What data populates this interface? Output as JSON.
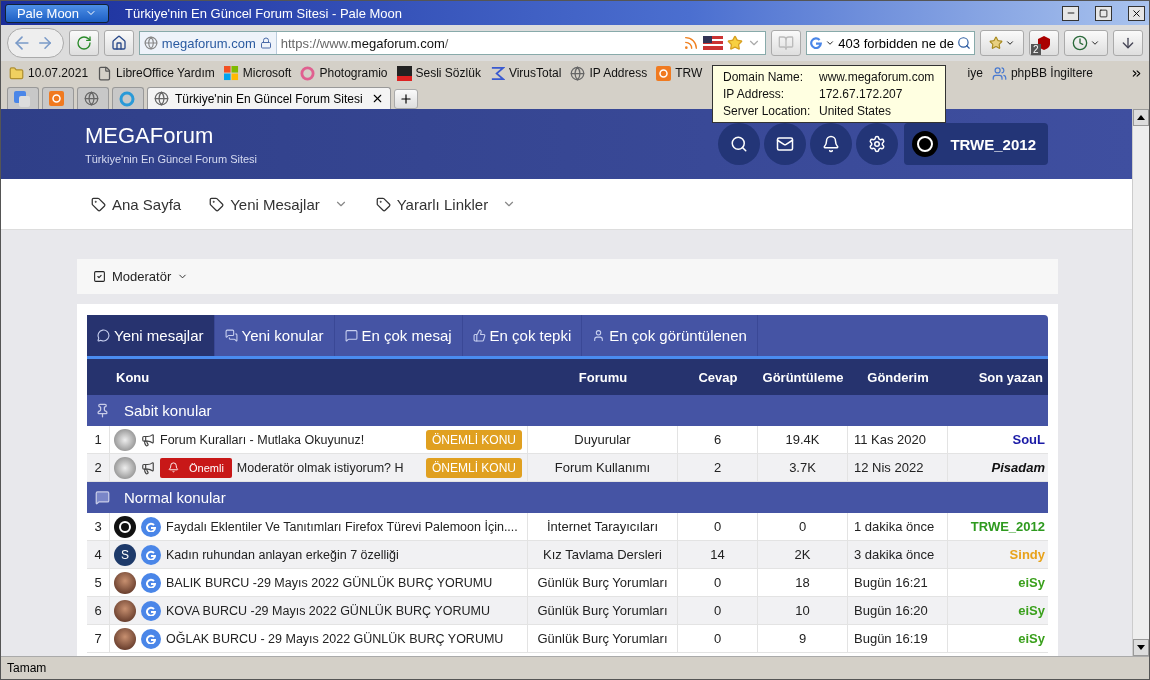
{
  "window": {
    "menu_button": "Pale Moon",
    "title": "Türkiye'nin En Güncel Forum Sitesi - Pale Moon"
  },
  "toolbar": {
    "identity": "megaforum.com",
    "url_parts": [
      {
        "text": "https://www.",
        "emphasis": false
      },
      {
        "text": "megaforum.com",
        "emphasis": true
      },
      {
        "text": "/",
        "emphasis": false
      }
    ],
    "search": "403 forbidden ne de",
    "addon_badge": "2"
  },
  "bookmarks": [
    {
      "label": "10.07.2021",
      "kind": "folder"
    },
    {
      "label": "LibreOffice Yardım",
      "kind": "page"
    },
    {
      "label": "Microsoft",
      "kind": "windows"
    },
    {
      "label": "Photogramio",
      "kind": "ring"
    },
    {
      "label": "Sesli Sözlük",
      "kind": "dict"
    },
    {
      "label": "VirusTotal",
      "kind": "sigma"
    },
    {
      "label": "IP Address",
      "kind": "globe"
    },
    {
      "label": "TRW",
      "kind": "xampp"
    },
    {
      "label": "iye",
      "kind": "none"
    },
    {
      "label": "phpBB İngiltere",
      "kind": "users"
    }
  ],
  "tabs": [
    {
      "kind": "translate",
      "selected": false
    },
    {
      "kind": "xampp",
      "selected": false
    },
    {
      "kind": "globe",
      "selected": false
    },
    {
      "kind": "refresh",
      "selected": false
    },
    {
      "kind": "globe",
      "label": "Türkiye'nin En Güncel Forum Sitesi",
      "selected": true
    }
  ],
  "tooltip": [
    {
      "name": "Domain Name:",
      "value": "www.megaforum.com"
    },
    {
      "name": "IP Address:",
      "value": "172.67.172.207"
    },
    {
      "name": "Server Location:",
      "value": "United States"
    }
  ],
  "site": {
    "title": "MEGAForum",
    "subtitle": "Türkiye'nin En Güncel Forum Sitesi",
    "header_buttons": [
      {
        "kind": "search"
      },
      {
        "kind": "mail"
      },
      {
        "kind": "bell"
      },
      {
        "kind": "settings"
      }
    ],
    "user": "TRWE_2012",
    "nav": [
      {
        "label": "Ana Sayfa",
        "dropdown": false
      },
      {
        "label": "Yeni Mesajlar",
        "dropdown": true
      },
      {
        "label": "Yararlı Linkler",
        "dropdown": true
      }
    ],
    "moderator": "Moderatör",
    "widget_tabs": [
      {
        "label": "Yeni mesajlar",
        "selected": true
      },
      {
        "label": "Yeni konular",
        "selected": false
      },
      {
        "label": "En çok mesaj",
        "selected": false
      },
      {
        "label": "En çok tepki",
        "selected": false
      },
      {
        "label": "En çok görüntülenen",
        "selected": false
      }
    ],
    "columns": [
      "Konu",
      "Forumu",
      "Cevap",
      "Görüntüleme",
      "Gönderim",
      "Son yazan"
    ],
    "sections": [
      {
        "title": "Sabit konular",
        "kind": "pin",
        "rows": [
          {
            "num": "1",
            "avatar": {
              "kind": "photo"
            },
            "prefix": "ÖNEMLİ KONU",
            "title": "Forum Kuralları - Mutlaka Okuyunuz!",
            "forum": "Duyurular",
            "replies": "6",
            "views": "19.4K",
            "date": "11 Kas 2020",
            "author": "SouL",
            "color": "#1a1aa6",
            "italic": false
          },
          {
            "num": "2",
            "avatar": {
              "kind": "photo"
            },
            "prefix": "ÖNEMLİ KONU",
            "flag": "Önemli",
            "title": "Moderatör olmak istiyorum? H",
            "forum": "Forum Kullanımı",
            "replies": "2",
            "views": "3.7K",
            "date": "12 Nis 2022",
            "author": "Pisadam",
            "color": "#111111",
            "italic": true
          }
        ]
      },
      {
        "title": "Normal konular",
        "kind": "chat",
        "rows": [
          {
            "num": "3",
            "avatar": {
              "kind": "logo"
            },
            "title": "Faydalı Eklentiler Ve Tanıtımları Firefox Türevi Palemoon İçin....",
            "forum": "İnternet Tarayıcıları",
            "replies": "0",
            "views": "0",
            "date": "1 dakika önce",
            "author": "TRWE_2012",
            "color": "#2e9a1f",
            "italic": false
          },
          {
            "num": "4",
            "avatar": {
              "kind": "letter",
              "letter": "S"
            },
            "title": "Kadın ruhundan anlayan erkeğin 7 özelliği",
            "forum": "Kız Tavlama Dersleri",
            "replies": "14",
            "views": "2K",
            "date": "3 dakika önce",
            "author": "Sindy",
            "color": "#e8a21a",
            "italic": false
          },
          {
            "num": "5",
            "avatar": {
              "kind": "portrait"
            },
            "title": "BALIK BURCU -29 Mayıs 2022 GÜNLÜK BURÇ YORUMU",
            "forum": "Günlük Burç Yorumları",
            "replies": "0",
            "views": "18",
            "date": "Bugün 16:21",
            "author": "eiSy",
            "color": "#3aa01c",
            "italic": false
          },
          {
            "num": "6",
            "avatar": {
              "kind": "portrait"
            },
            "title": "KOVA BURCU -29 Mayıs 2022 GÜNLÜK BURÇ YORUMU",
            "forum": "Günlük Burç Yorumları",
            "replies": "0",
            "views": "10",
            "date": "Bugün 16:20",
            "author": "eiSy",
            "color": "#3aa01c",
            "italic": false
          },
          {
            "num": "7",
            "avatar": {
              "kind": "portrait"
            },
            "title": "OĞLAK BURCU - 29 Mayıs 2022 GÜNLÜK BURÇ YORUMU",
            "forum": "Günlük Burç Yorumları",
            "replies": "0",
            "views": "9",
            "date": "Bugün 16:19",
            "author": "eiSy",
            "color": "#3aa01c",
            "italic": false
          }
        ]
      }
    ]
  },
  "status_bar": "Tamam"
}
